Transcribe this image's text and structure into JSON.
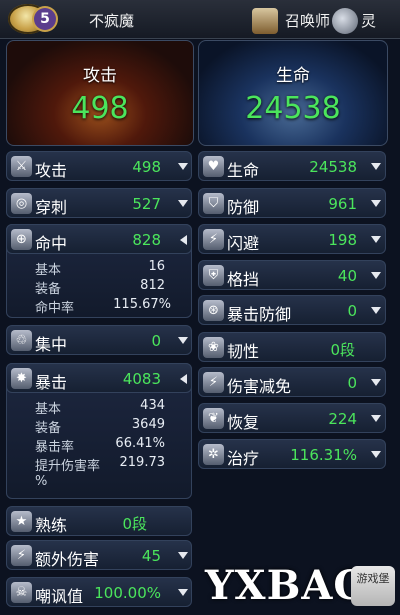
{
  "header": {
    "level": "5",
    "player_name": "不疯魔",
    "summon_label": "召唤师",
    "spirit_label": "灵"
  },
  "panels": {
    "attack": {
      "label": "攻击",
      "value": "498"
    },
    "health": {
      "label": "生命",
      "value": "24538"
    }
  },
  "left_stats": [
    {
      "label": "攻击",
      "value": "498",
      "icon": "sword-icon"
    },
    {
      "label": "穿刺",
      "value": "527",
      "icon": "pierce-icon"
    },
    {
      "label": "命中",
      "value": "828",
      "icon": "target-icon"
    },
    {
      "label": "集中",
      "value": "0",
      "icon": "focus-icon"
    },
    {
      "label": "暴击",
      "value": "4083",
      "icon": "burst-icon"
    },
    {
      "label": "熟练",
      "value": "0段",
      "icon": "star-icon"
    },
    {
      "label": "额外伤害",
      "value": "45",
      "icon": "lightning-icon"
    },
    {
      "label": "嘲讽值",
      "value": "100.00%",
      "icon": "skull-icon"
    }
  ],
  "hit_details": [
    {
      "label": "基本",
      "value": "16"
    },
    {
      "label": "装备",
      "value": "812"
    },
    {
      "label": "命中率",
      "value": "115.67%"
    }
  ],
  "crit_details": [
    {
      "label": "基本",
      "value": "434"
    },
    {
      "label": "装备",
      "value": "3649"
    },
    {
      "label": "暴击率",
      "value": "66.41%"
    },
    {
      "label": "提升伤害率",
      "value": "219.73"
    },
    {
      "label": "",
      "value": "%"
    }
  ],
  "right_stats": [
    {
      "label": "生命",
      "value": "24538",
      "icon": "heart-icon"
    },
    {
      "label": "防御",
      "value": "961",
      "icon": "shield-icon"
    },
    {
      "label": "闪避",
      "value": "198",
      "icon": "dodge-icon"
    },
    {
      "label": "格挡",
      "value": "40",
      "icon": "block-icon"
    },
    {
      "label": "暴击防御",
      "value": "0",
      "icon": "crit-defense-icon"
    },
    {
      "label": "韧性",
      "value": "0段",
      "icon": "toughness-icon"
    },
    {
      "label": "伤害减免",
      "value": "0",
      "icon": "damage-reduction-icon"
    },
    {
      "label": "恢复",
      "value": "224",
      "icon": "recovery-icon"
    },
    {
      "label": "治疗",
      "value": "116.31%",
      "icon": "heal-icon"
    }
  ],
  "watermark": {
    "text": "YXBAO",
    "tag": "游戏堡"
  }
}
